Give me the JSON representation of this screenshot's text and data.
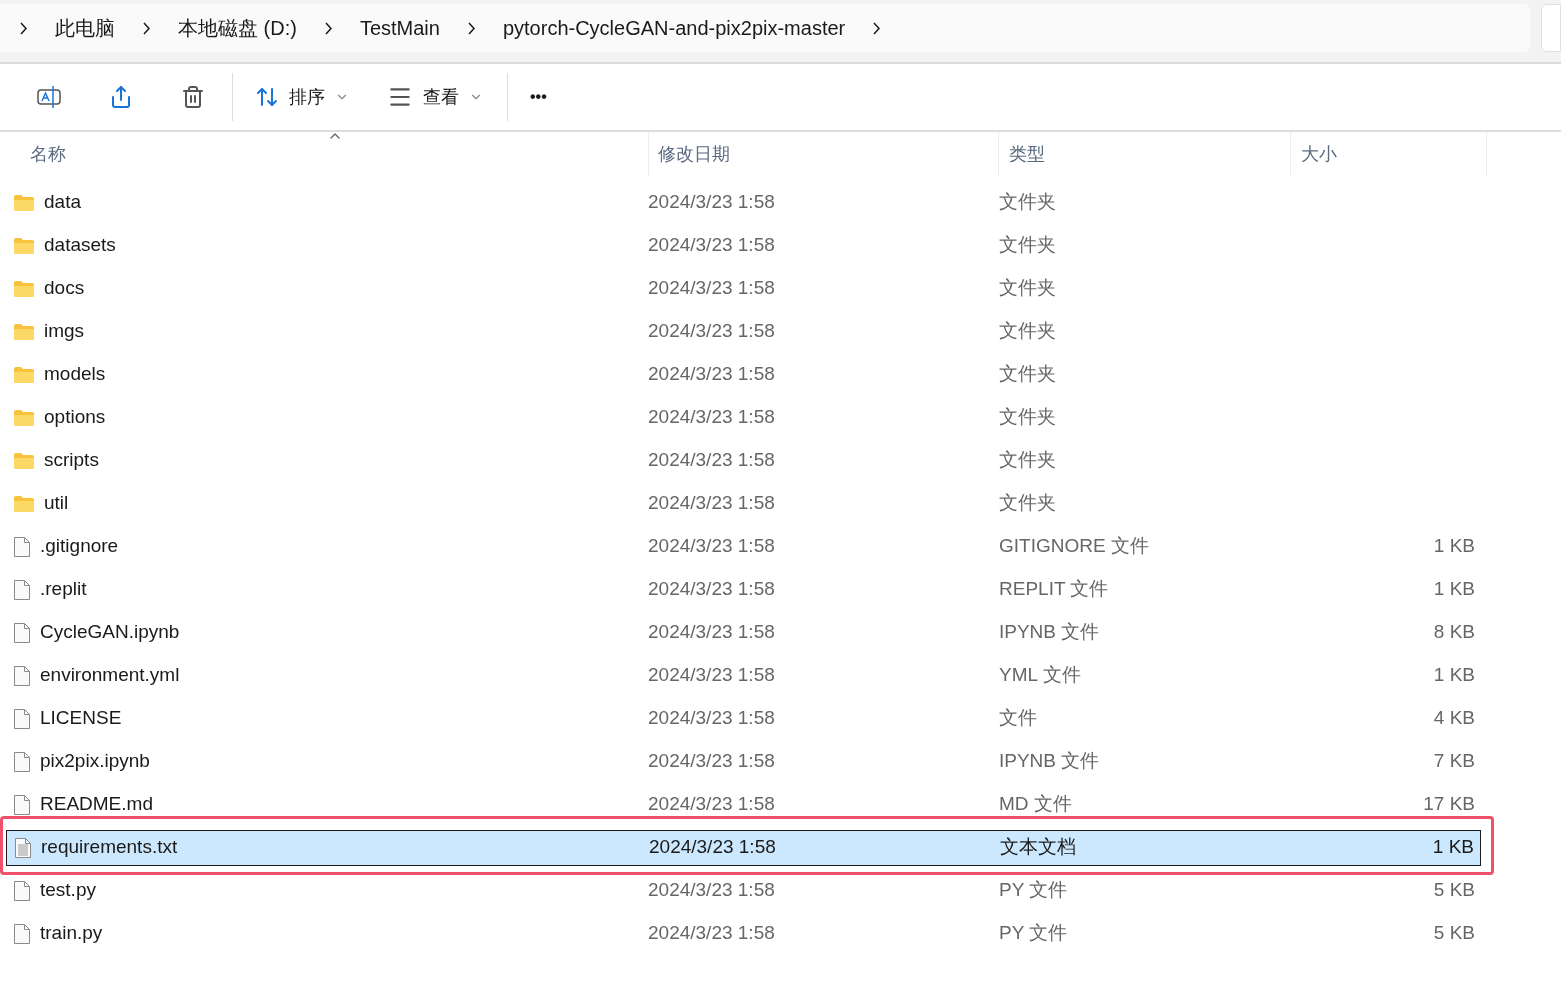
{
  "breadcrumb": [
    "此电脑",
    "本地磁盘 (D:)",
    "TestMain",
    "pytorch-CycleGAN-and-pix2pix-master"
  ],
  "toolbar": {
    "sort_label": "排序",
    "view_label": "查看",
    "more": "•••"
  },
  "columns": [
    "名称",
    "修改日期",
    "类型",
    "大小"
  ],
  "rows": [
    {
      "kind": "folder",
      "name": "data",
      "date": "2024/3/23 1:58",
      "type": "文件夹",
      "selected": false,
      "annotated": false
    },
    {
      "kind": "folder",
      "name": "datasets",
      "date": "2024/3/23 1:58",
      "type": "文件夹",
      "selected": false,
      "annotated": false
    },
    {
      "kind": "folder",
      "name": "docs",
      "date": "2024/3/23 1:58",
      "type": "文件夹",
      "selected": false,
      "annotated": false
    },
    {
      "kind": "folder",
      "name": "imgs",
      "date": "2024/3/23 1:58",
      "type": "文件夹",
      "selected": false,
      "annotated": false
    },
    {
      "kind": "folder",
      "name": "models",
      "date": "2024/3/23 1:58",
      "type": "文件夹",
      "selected": false,
      "annotated": false
    },
    {
      "kind": "folder",
      "name": "options",
      "date": "2024/3/23 1:58",
      "type": "文件夹",
      "selected": false,
      "annotated": false
    },
    {
      "kind": "folder",
      "name": "scripts",
      "date": "2024/3/23 1:58",
      "type": "文件夹",
      "selected": false,
      "annotated": false
    },
    {
      "kind": "folder",
      "name": "util",
      "date": "2024/3/23 1:58",
      "type": "文件夹",
      "selected": false,
      "annotated": false
    },
    {
      "kind": "file",
      "name": ".gitignore",
      "date": "2024/3/23 1:58",
      "type": "GITIGNORE 文件",
      "size": "1 KB",
      "selected": false,
      "annotated": false
    },
    {
      "kind": "file",
      "name": ".replit",
      "date": "2024/3/23 1:58",
      "type": "REPLIT 文件",
      "size": "1 KB",
      "selected": false,
      "annotated": false
    },
    {
      "kind": "file",
      "name": "CycleGAN.ipynb",
      "date": "2024/3/23 1:58",
      "type": "IPYNB 文件",
      "size": "8 KB",
      "selected": false,
      "annotated": false
    },
    {
      "kind": "file",
      "name": "environment.yml",
      "date": "2024/3/23 1:58",
      "type": "YML 文件",
      "size": "1 KB",
      "selected": false,
      "annotated": false
    },
    {
      "kind": "file",
      "name": "LICENSE",
      "date": "2024/3/23 1:58",
      "type": "文件",
      "size": "4 KB",
      "selected": false,
      "annotated": false
    },
    {
      "kind": "file",
      "name": "pix2pix.ipynb",
      "date": "2024/3/23 1:58",
      "type": "IPYNB 文件",
      "size": "7 KB",
      "selected": false,
      "annotated": false
    },
    {
      "kind": "file",
      "name": "README.md",
      "date": "2024/3/23 1:58",
      "type": "MD 文件",
      "size": "17 KB",
      "selected": false,
      "annotated": false
    },
    {
      "kind": "text",
      "name": "requirements.txt",
      "date": "2024/3/23 1:58",
      "type": "文本文档",
      "size": "1 KB",
      "selected": true,
      "annotated": true
    },
    {
      "kind": "file",
      "name": "test.py",
      "date": "2024/3/23 1:58",
      "type": "PY 文件",
      "size": "5 KB",
      "selected": false,
      "annotated": false
    },
    {
      "kind": "file",
      "name": "train.py",
      "date": "2024/3/23 1:58",
      "type": "PY 文件",
      "size": "5 KB",
      "selected": false,
      "annotated": false
    }
  ]
}
